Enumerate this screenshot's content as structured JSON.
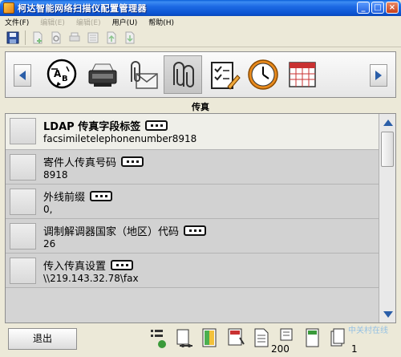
{
  "window": {
    "title": "柯达智能网络扫描仪配置管理器",
    "buttons": {
      "minimize": "_",
      "maximize": "□",
      "close": "×"
    }
  },
  "menu": {
    "items": [
      {
        "label": "文件(F)",
        "enabled": true
      },
      {
        "label": "编辑(E)",
        "enabled": false
      },
      {
        "label": "编辑(E)",
        "enabled": false
      },
      {
        "label": "用户(U)",
        "enabled": true
      },
      {
        "label": "帮助(H)",
        "enabled": true
      }
    ]
  },
  "toolbar": {
    "icons": [
      "save-icon",
      "new-icon",
      "search-doc-icon",
      "print-icon",
      "list-icon",
      "export-icon",
      "import-icon"
    ]
  },
  "carousel": {
    "categories": [
      {
        "name": "language-icon",
        "selected": false
      },
      {
        "name": "scanner-icon",
        "selected": false
      },
      {
        "name": "email-attachment-icon",
        "selected": false
      },
      {
        "name": "fax-attachment-icon",
        "selected": true
      },
      {
        "name": "checklist-icon",
        "selected": false
      },
      {
        "name": "clock-icon",
        "selected": false
      },
      {
        "name": "calendar-icon",
        "selected": false
      }
    ]
  },
  "section": {
    "title": "传真"
  },
  "fields": [
    {
      "label": "LDAP 传真字段标签",
      "value": "facsimiletelephonenumber8918"
    },
    {
      "label": "寄件人传真号码",
      "value": "8918"
    },
    {
      "label": "外线前缀",
      "value": "0,"
    },
    {
      "label": "调制解调器国家（地区）代码",
      "value": "26"
    },
    {
      "label": "传入传真设置",
      "value": "\\\\219.143.32.78\\fax"
    }
  ],
  "bottom": {
    "exit_label": "退出",
    "status_counts": {
      "scanned": "200",
      "pages": "1"
    },
    "watermark": "中关村在线"
  },
  "colors": {
    "titlebar": "#0b53d1",
    "accent": "#2a5ea8",
    "list_bg": "#d2d2d2",
    "selected_row": "#efefe9"
  }
}
